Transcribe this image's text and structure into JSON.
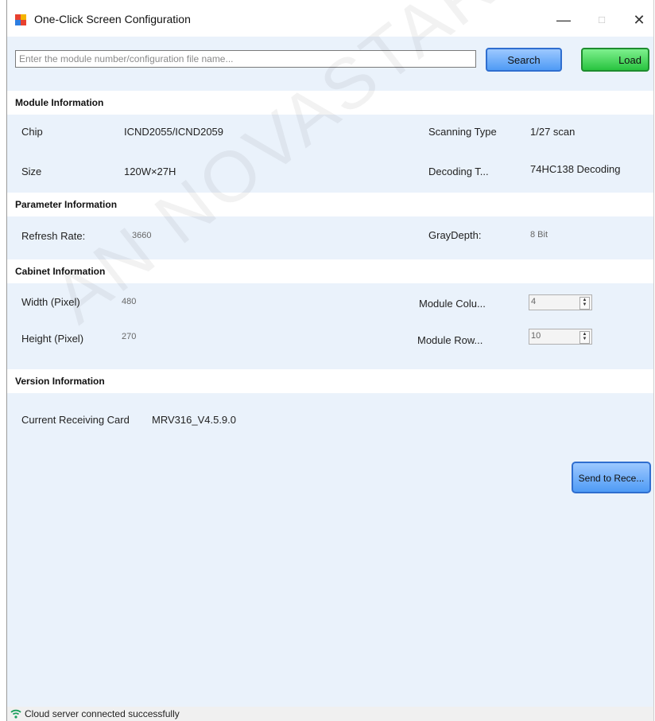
{
  "window": {
    "title": "One-Click Screen Configuration",
    "controls": {
      "minimize": "—",
      "maximize": "□",
      "close": "✕"
    }
  },
  "search": {
    "placeholder": "Enter the module number/configuration file name...",
    "value": "",
    "search_label": "Search",
    "load_label": "Load"
  },
  "module_info": {
    "heading": "Module Information",
    "chip_label": "Chip",
    "chip_value": "ICND2055/ICND2059",
    "scanning_label": "Scanning Type",
    "scanning_value": "1/27 scan",
    "size_label": "Size",
    "size_value": "120W×27H",
    "decoding_label": "Decoding T...",
    "decoding_value": "74HC138 Decoding"
  },
  "parameter_info": {
    "heading": "Parameter Information",
    "refresh_label": "Refresh Rate:",
    "refresh_value": "3660",
    "gray_label": "GrayDepth:",
    "gray_value": "8 Bit"
  },
  "cabinet_info": {
    "heading": "Cabinet Information",
    "width_label": "Width (Pixel)",
    "width_value": "480",
    "height_label": "Height (Pixel)",
    "height_value": "270",
    "columns_label": "Module Colu...",
    "columns_value": "4",
    "rows_label": "Module Row...",
    "rows_value": "10"
  },
  "version_info": {
    "heading": "Version Information",
    "card_label": "Current Receiving Card",
    "card_value": "MRV316_V4.5.9.0"
  },
  "send_button_label": "Send to Rece...",
  "status": {
    "text": "Cloud server connected successfully"
  },
  "watermark_text": "AN NOVASTAR",
  "colors": {
    "client_bg": "#eaf2fb",
    "search_button": "#4f9bf5",
    "load_button": "#28c43f",
    "status_icon": "#1a9e5c"
  }
}
